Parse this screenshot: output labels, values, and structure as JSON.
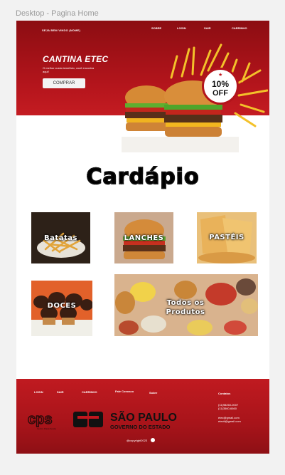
{
  "frame_label": "Desktop - Pagina Home",
  "header": {
    "welcome": "SEJA BEM VINDO (NOME)",
    "nav": [
      "SOBRE",
      "LOGIN",
      "SAIR",
      "CARRINHO"
    ],
    "title": "CANTINA ETEC",
    "subtitle": "O melhor custo-benefício, você encontra aqui!",
    "buy_label": "COMPRAR",
    "promo_pct": "10%",
    "promo_off": "OFF"
  },
  "menu": {
    "title": "Cardápio",
    "cards": [
      "Batatas",
      "LANCHES",
      "PASTÉIS",
      "DOCES",
      "Todos os",
      "Produtos"
    ]
  },
  "footer": {
    "nav": [
      "LOGIN",
      "SAIR",
      "CARRINHO",
      "Fale Conosco",
      "Sobre"
    ],
    "contact_heading": "Contatos",
    "phones": [
      "(11)98260-0007",
      "(11)3560-6660"
    ],
    "emails": [
      "etec@gmail.com",
      "etecti@gmail.com"
    ],
    "copyright": "@copyright2023",
    "cps_text": "cps",
    "cps_sub": "Centro Paula Souza",
    "sp_title": "SÃO PAULO",
    "sp_sub": "GOVERNO DO ESTADO"
  },
  "colors": {
    "brand_red": "#b5151c",
    "dark_red": "#8c0d12"
  }
}
